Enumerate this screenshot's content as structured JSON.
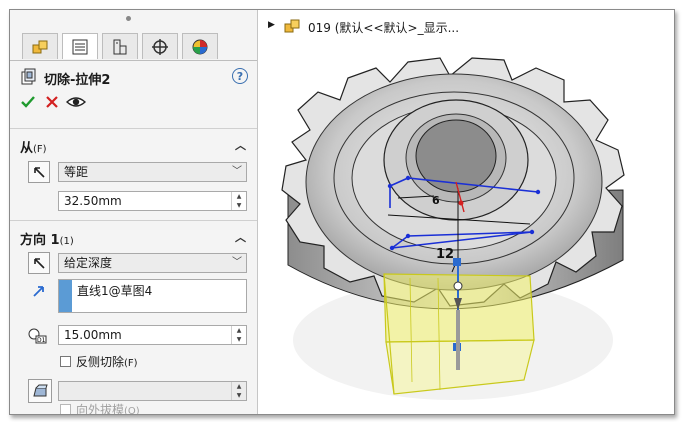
{
  "feature": {
    "title": "切除-拉伸2",
    "help_label": "?"
  },
  "tabs": [
    "feature-manager-icon",
    "property-manager-icon",
    "configuration-manager-icon",
    "dimxpert-icon",
    "display-manager-icon"
  ],
  "from_section": {
    "label": "从",
    "hotkey": "(F)",
    "end_condition": "等距",
    "offset": "32.50mm"
  },
  "direction1": {
    "label": "方向 1",
    "hotkey": "(1)",
    "end_condition": "给定深度",
    "direction_ref": "直线1@草图4",
    "depth": "15.00mm",
    "flip_side_label": "反侧切除",
    "flip_side_hotkey": "(F)",
    "flip_side_checked": false,
    "draft_value": "",
    "draft_outward_label": "向外拔模",
    "draft_outward_hotkey": "(O)"
  },
  "viewport": {
    "tree_text": "019  (默认<<默认>_显示...",
    "dimension_12": "12",
    "dimension_6": "6"
  },
  "colors": {
    "accent_blue": "#5b9bd5",
    "ok_green": "#1f9a2e",
    "cancel_red": "#d32020",
    "sketch_blue": "#1a2fd6",
    "preview_yellow": "#e8e83a"
  }
}
